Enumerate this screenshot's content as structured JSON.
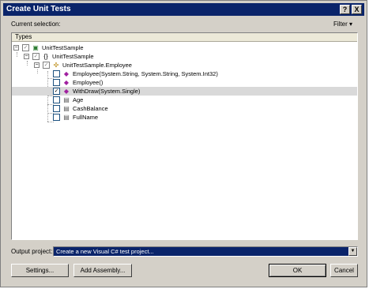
{
  "window": {
    "title": "Create Unit Tests",
    "help_label": "?",
    "close_label": "X"
  },
  "current_selection_label": "Current selection:",
  "filter_label": "Filter",
  "filter_arrow": "▾",
  "tree": {
    "column_header": "Types",
    "nodes": [
      {
        "label": "UnitTestSample",
        "icon": "project-icon",
        "expander": "⊟",
        "checked": "gray"
      },
      {
        "label": "UnitTestSample",
        "icon": "namespace-icon",
        "expander": "⊟",
        "checked": "gray"
      },
      {
        "label": "UnitTestSample.Employee",
        "icon": "class-icon",
        "expander": "⊟",
        "checked": "gray"
      },
      {
        "label": "Employee(System.String, System.String, System.Int32)",
        "icon": "method-icon",
        "checked": "no"
      },
      {
        "label": "Employee()",
        "icon": "method-icon",
        "checked": "no"
      },
      {
        "label": "WithDraw(System.Single)",
        "icon": "method-icon",
        "checked": "yes"
      },
      {
        "label": "Age",
        "icon": "property-icon",
        "checked": "no"
      },
      {
        "label": "CashBalance",
        "icon": "property-icon",
        "checked": "no"
      },
      {
        "label": "FullName",
        "icon": "property-icon",
        "checked": "no"
      }
    ]
  },
  "output_project": {
    "label": "Output project:",
    "value": "Create a new Visual C# test project..."
  },
  "buttons": {
    "settings": "Settings...",
    "add_assembly": "Add Assembly...",
    "ok": "OK",
    "cancel": "Cancel"
  }
}
